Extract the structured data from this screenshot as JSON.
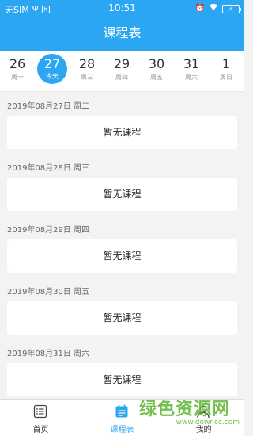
{
  "status_bar": {
    "carrier": "无SIM",
    "time": "10:51"
  },
  "header": {
    "title": "课程表"
  },
  "week": [
    {
      "num": "26",
      "label": "周一",
      "active": false
    },
    {
      "num": "27",
      "label": "今天",
      "active": true
    },
    {
      "num": "28",
      "label": "周三",
      "active": false
    },
    {
      "num": "29",
      "label": "周四",
      "active": false
    },
    {
      "num": "30",
      "label": "周五",
      "active": false
    },
    {
      "num": "31",
      "label": "周六",
      "active": false
    },
    {
      "num": "1",
      "label": "周日",
      "active": false
    }
  ],
  "days": [
    {
      "date": "2019年08月27日 周二",
      "content": "暂无课程"
    },
    {
      "date": "2019年08月28日 周三",
      "content": "暂无课程"
    },
    {
      "date": "2019年08月29日 周四",
      "content": "暂无课程"
    },
    {
      "date": "2019年08月30日 周五",
      "content": "暂无课程"
    },
    {
      "date": "2019年08月31日 周六",
      "content": "暂无课程"
    }
  ],
  "tabs": [
    {
      "label": "首页",
      "icon": "home-list-icon",
      "active": false
    },
    {
      "label": "课程表",
      "icon": "calendar-icon",
      "active": true
    },
    {
      "label": "我的",
      "icon": "user-icon",
      "active": false
    }
  ],
  "watermark": {
    "text": "绿色资源网",
    "url": "www.downcc.com"
  },
  "colors": {
    "accent": "#2aa6f2",
    "background": "#f3f3f3",
    "watermark": "#5cb531"
  }
}
